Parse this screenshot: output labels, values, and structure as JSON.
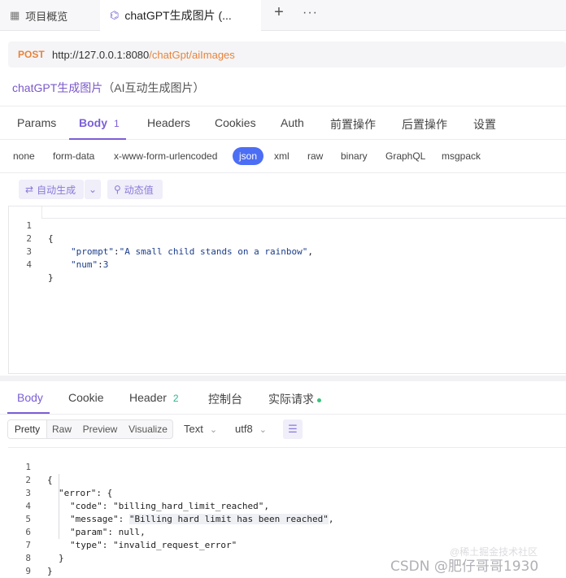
{
  "tabs": {
    "overview": {
      "icon": "table-icon",
      "label": "项目概览"
    },
    "request": {
      "icon": "request-icon",
      "label": "chatGPT生成图片 (..."
    },
    "add": "+",
    "more": "···"
  },
  "url_bar": {
    "method": "POST",
    "host": "http://127.0.0.1:8080",
    "path": "/chatGpt/aiImages"
  },
  "request_name": {
    "name": "chatGPT生成图片",
    "desc": "（AI互动生成图片）"
  },
  "request_tabs": [
    {
      "label": "Params"
    },
    {
      "label": "Body",
      "badge": "1"
    },
    {
      "label": "Headers"
    },
    {
      "label": "Cookies"
    },
    {
      "label": "Auth"
    },
    {
      "label": "前置操作"
    },
    {
      "label": "后置操作"
    },
    {
      "label": "设置"
    }
  ],
  "body_types": [
    "none",
    "form-data",
    "x-www-form-urlencoded",
    "json",
    "xml",
    "raw",
    "binary",
    "GraphQL",
    "msgpack"
  ],
  "body_type_selected": "json",
  "tools": {
    "auto_generate": "自动生成",
    "dynamic_value": "动态值"
  },
  "request_code": {
    "line_numbers": [
      "1",
      "2",
      "3",
      "4"
    ],
    "l1": "{",
    "l2_key": "\"prompt\"",
    "l2_colon": ":",
    "l2_val": "\"A small child stands on a rainbow\"",
    "l2_end": ",",
    "l3_key": "\"num\"",
    "l3_colon": ":",
    "l3_val": "3",
    "l4": "}"
  },
  "response_tabs": [
    {
      "label": "Body"
    },
    {
      "label": "Cookie"
    },
    {
      "label": "Header",
      "badge": "2"
    },
    {
      "label": "控制台"
    },
    {
      "label": "实际请求"
    }
  ],
  "format_buttons": [
    "Pretty",
    "Raw",
    "Preview",
    "Visualize"
  ],
  "format_selected": "Pretty",
  "text_select": "Text",
  "encoding_select": "utf8",
  "response_code": {
    "line_numbers": [
      "1",
      "2",
      "3",
      "4",
      "5",
      "6",
      "7",
      "8",
      "9"
    ],
    "l1": "{",
    "l2": "\"error\": {",
    "l3": "\"code\": \"billing_hard_limit_reached\",",
    "l4a": "\"message\": ",
    "l4b": "\"Billing hard limit has been reached\"",
    "l4c": ",",
    "l5": "\"param\": null,",
    "l6": "\"type\": \"invalid_request_error\"",
    "l7": "}",
    "l8": "}",
    "l9": ""
  },
  "watermark": {
    "back": "@稀土掘金技术社区",
    "front": "CSDN @肥仔哥哥1930"
  },
  "colors": {
    "accent": "#7b5fd6",
    "method": "#e8833a",
    "json_active": "#4c6ef5"
  }
}
